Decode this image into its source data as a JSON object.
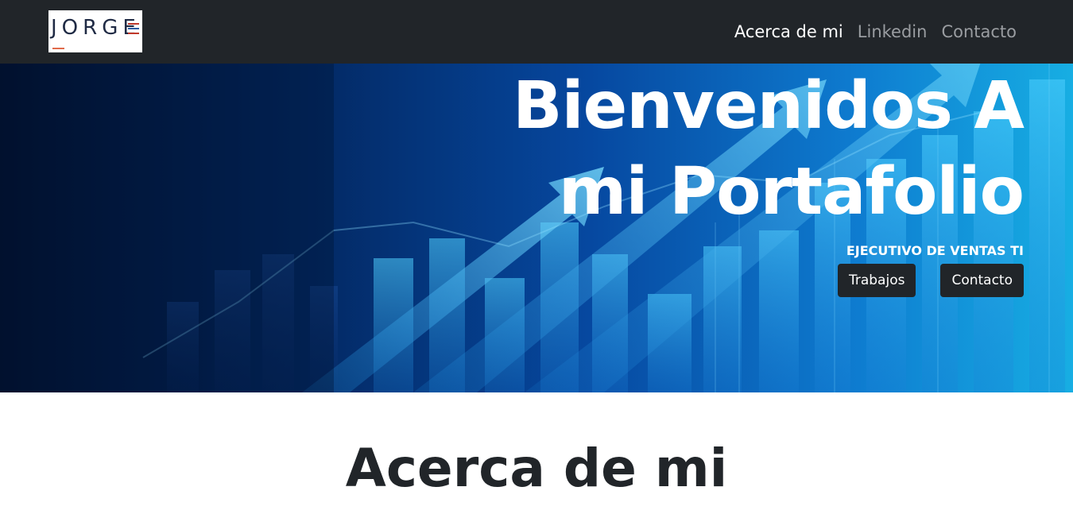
{
  "navbar": {
    "logo": {
      "text": "JORGE"
    },
    "links": [
      {
        "label": "Acerca de mi",
        "active": true
      },
      {
        "label": "Linkedin",
        "active": false
      },
      {
        "label": "Contacto",
        "active": false
      }
    ]
  },
  "hero": {
    "title_line1": "Bienvenidos A",
    "title_line2": "mi Portafolio",
    "subtitle": "EJECUTIVO DE VENTAS TI",
    "buttons": {
      "trabajos": "Trabajos",
      "contacto": "Contacto"
    }
  },
  "about": {
    "title": "Acerca de mi"
  },
  "colors": {
    "navbar_bg": "#212529",
    "nav_active": "#ffffff",
    "nav_inactive": "#9a9da1",
    "hero_dark": "#02112f",
    "hero_light": "#17aee3",
    "button_bg": "#212529",
    "logo_accent": "#e06a4a"
  }
}
